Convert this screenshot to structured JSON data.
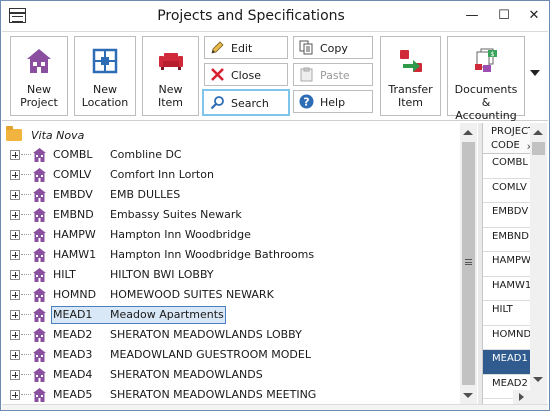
{
  "window": {
    "title": "Projects and Specifications",
    "controls": {
      "minimize": "—",
      "maximize": "☐",
      "close": "✕"
    }
  },
  "toolbar": {
    "new_project": "New Project",
    "new_location": "New Location",
    "new_item": "New Item",
    "edit": "Edit",
    "close": "Close",
    "search": "Search",
    "copy": "Copy",
    "paste": "Paste",
    "help": "Help",
    "transfer_item": "Transfer Item",
    "documents_accounting": "Documents & Accounting"
  },
  "tree": {
    "root": "Vita Nova",
    "items": [
      {
        "code": "COMBL",
        "name": "Combline DC"
      },
      {
        "code": "COMLV",
        "name": "Comfort Inn Lorton"
      },
      {
        "code": "EMBDV",
        "name": "EMB DULLES"
      },
      {
        "code": "EMBND",
        "name": "Embassy Suites Newark"
      },
      {
        "code": "HAMPW",
        "name": "Hampton Inn Woodbridge"
      },
      {
        "code": "HAMW1",
        "name": "Hampton Inn Woodbridge Bathrooms"
      },
      {
        "code": "HILT",
        "name": "HILTON  BWI LOBBY"
      },
      {
        "code": "HOMND",
        "name": "HOMEWOOD SUITES NEWARK"
      },
      {
        "code": "MEAD1",
        "name": "Meadow Apartments"
      },
      {
        "code": "MEAD2",
        "name": "SHERATON MEADOWLANDS LOBBY"
      },
      {
        "code": "MEAD3",
        "name": "MEADOWLAND GUESTROOM MODEL"
      },
      {
        "code": "MEAD4",
        "name": "SHERATON MEADOWLANDS"
      },
      {
        "code": "MEAD5",
        "name": "SHERATON MEADOWLANDS MEETING"
      }
    ],
    "selected_code": "MEAD1"
  },
  "grid": {
    "header_line1": "PROJECT",
    "header_line2": "CODE",
    "sort_indicator": "x",
    "rows": [
      "COMBL",
      "COMLV",
      "EMBDV",
      "EMBND",
      "HAMPW",
      "HAMW1",
      "HILT",
      "HOMND",
      "MEAD1",
      "MEAD2"
    ]
  },
  "colors": {
    "accent": "#2f5b8f",
    "selection_fill": "#d9e8f6",
    "building_icon": "#8a4f9e",
    "folder": "#f1b53f"
  }
}
